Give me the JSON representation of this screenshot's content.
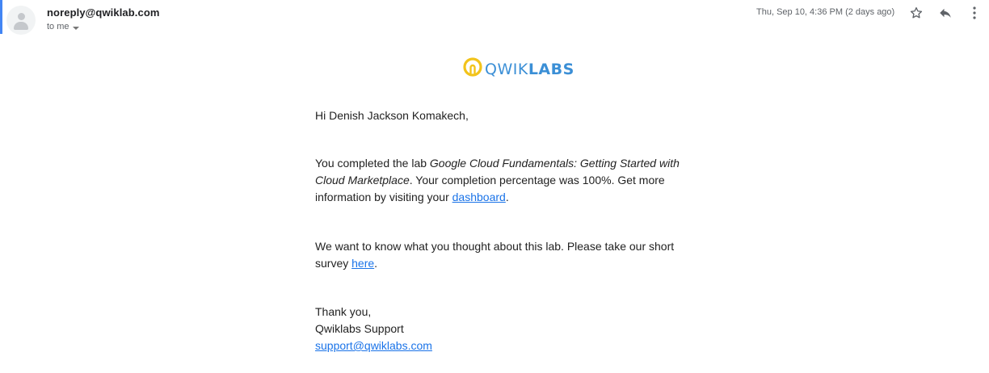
{
  "header": {
    "sender": "noreply@qwiklab.com",
    "recipient": "to me",
    "timestamp": "Thu, Sep 10, 4:36 PM (2 days ago)",
    "icons": {
      "avatar": "avatar-icon",
      "star": "star-icon",
      "reply": "reply-icon",
      "more": "more-vert-icon"
    }
  },
  "logo": {
    "prefix": "QWIK",
    "suffix": "LABS",
    "icon": "qwiklabs-logo-icon",
    "colors": {
      "mark": "#f2c31a",
      "text": "#3b8fd6"
    }
  },
  "body": {
    "greeting": "Hi Denish Jackson Komakech,",
    "para1_before": "You completed the lab ",
    "lab_name": "Google Cloud Fundamentals: Getting Started with Cloud Marketplace",
    "para1_middle": ". Your completion percentage was 100%. Get more information by visiting your ",
    "dashboard_link": "dashboard",
    "para1_end": ".",
    "para2_before": "We want to know what you thought about this lab. Please take our short survey ",
    "survey_link": "here",
    "para2_end": ".",
    "signoff_thanks": "Thank you,",
    "signoff_name": "Qwiklabs Support",
    "signoff_email": "support@qwiklabs.com"
  },
  "colors": {
    "link": "#1a73e8",
    "accent_bar": "#4285f4"
  }
}
